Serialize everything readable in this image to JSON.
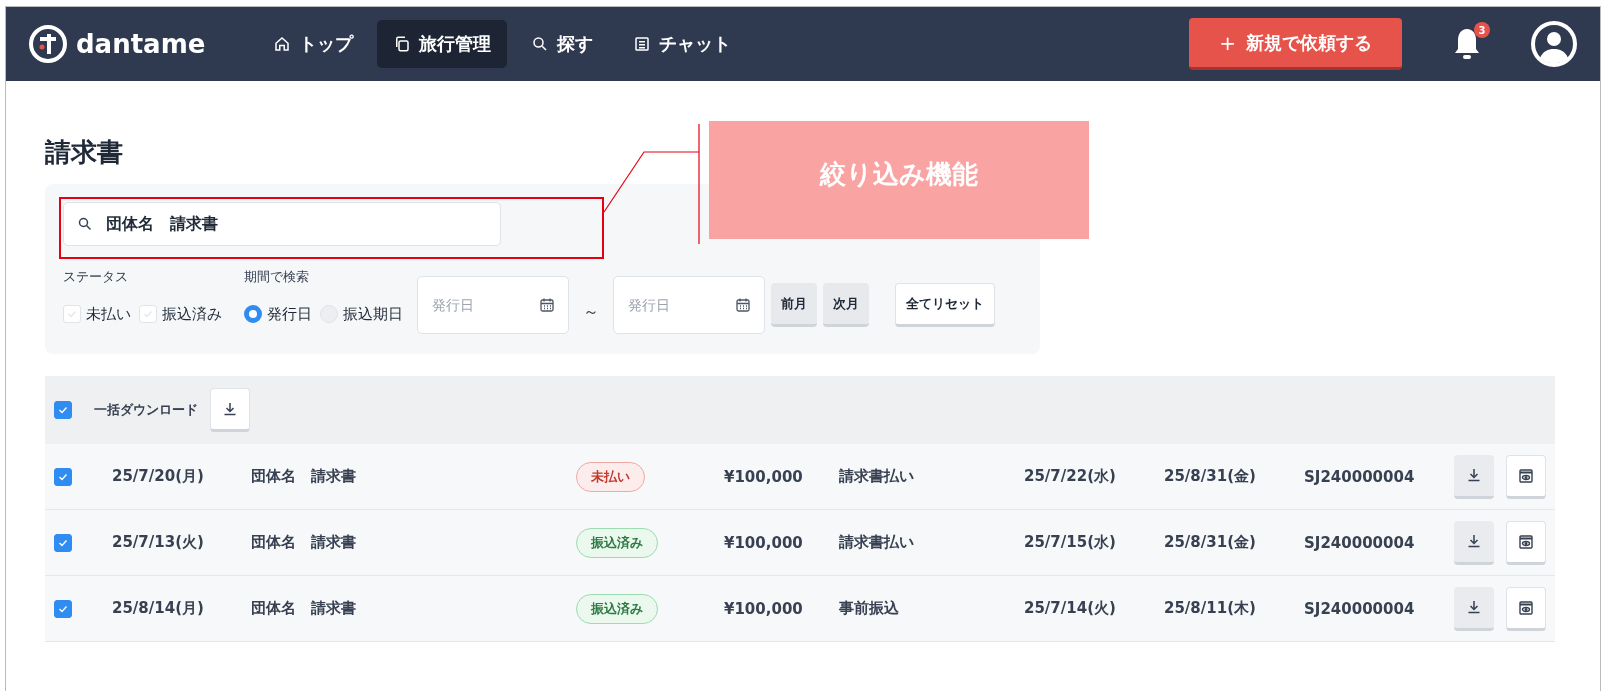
{
  "nav": {
    "logo": "dantame",
    "items": [
      {
        "label": "トップ",
        "kind": "home",
        "selected": false
      },
      {
        "label": "旅行管理",
        "kind": "copy",
        "selected": true
      },
      {
        "label": "探す",
        "kind": "search",
        "selected": false
      },
      {
        "label": "チャット",
        "kind": "list",
        "selected": false
      }
    ],
    "new_button": {
      "icon": "+",
      "label": "新規で依頼する"
    },
    "notifications": "3"
  },
  "page_title": "請求書",
  "filters": {
    "search": {
      "value": "団体名　請求書"
    },
    "status_label": "ステータス",
    "statuses": [
      {
        "label": "未払い",
        "checked": false
      },
      {
        "label": "振込済み",
        "checked": false
      }
    ],
    "period_label": "期間で検索",
    "period_options": [
      {
        "label": "発行日",
        "selected": true
      },
      {
        "label": "振込期日",
        "selected": false
      }
    ],
    "date_from": {
      "placeholder": "発行日"
    },
    "separator": "～",
    "date_to": {
      "placeholder": "発行日"
    },
    "buttons": [
      {
        "label": "前月",
        "kind": "gray"
      },
      {
        "label": "次月",
        "kind": "gray"
      },
      {
        "label": "全てリセット",
        "kind": "white"
      }
    ]
  },
  "bulk": {
    "checked": true,
    "label": "一括ダウンロード"
  },
  "rows": [
    {
      "checked": true,
      "date": "25/7/20(月)",
      "name": "団体名　請求書",
      "status": {
        "kind": "unpaid",
        "label": "未払い"
      },
      "amount": "¥100,000",
      "method": "請求書払い",
      "column_7": "25/7/22(水)",
      "column_8": "25/8/31(金)",
      "code": "SJ240000004"
    },
    {
      "checked": true,
      "date": "25/7/13(火)",
      "name": "団体名　請求書",
      "status": {
        "kind": "paid",
        "label": "振込済み"
      },
      "amount": "¥100,000",
      "method": "請求書払い",
      "column_7": "25/7/15(水)",
      "column_8": "25/8/31(金)",
      "code": "SJ240000004"
    },
    {
      "checked": true,
      "date": "25/8/14(月)",
      "name": "団体名　請求書",
      "status": {
        "kind": "paid",
        "label": "振込済み"
      },
      "amount": "¥100,000",
      "method": "事前振込",
      "column_7": "25/7/14(火)",
      "column_8": "25/8/11(木)",
      "code": "SJ240000004"
    }
  ],
  "annotation": {
    "label": "絞り込み機能"
  }
}
